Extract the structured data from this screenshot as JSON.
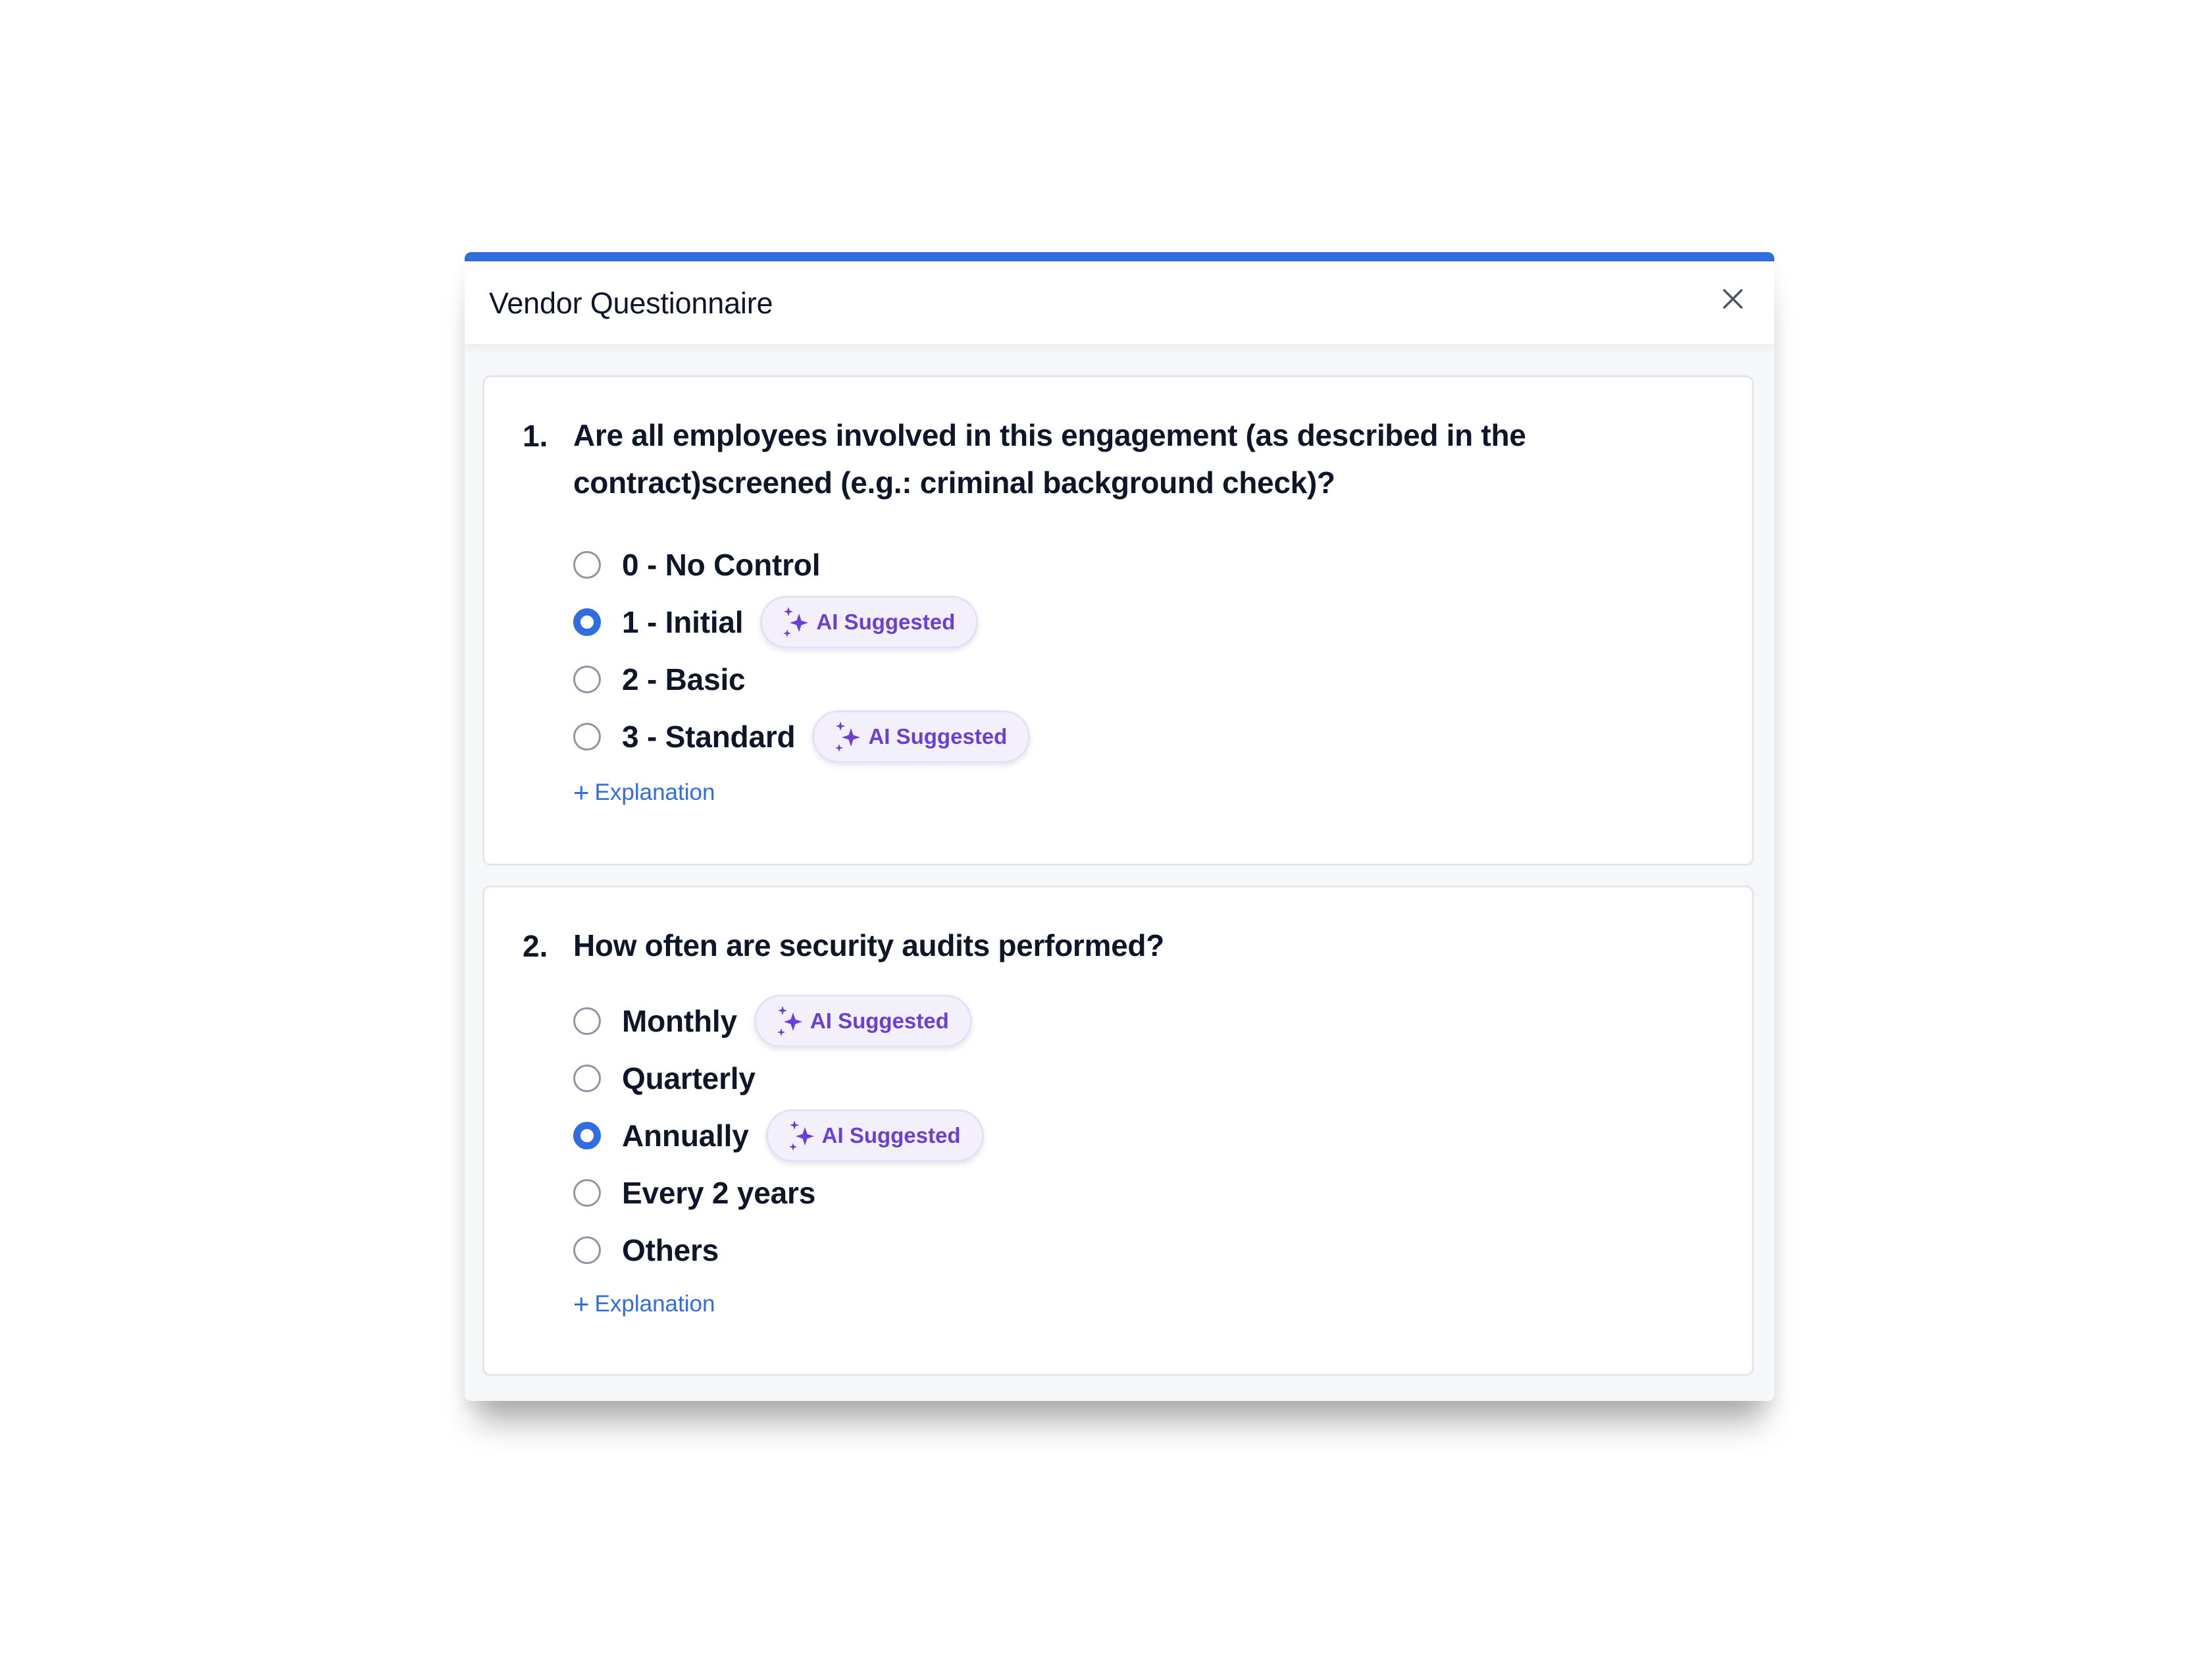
{
  "modal": {
    "title": "Vendor Questionnaire",
    "accent_color": "#2f6de0"
  },
  "questions": [
    {
      "number": "1.",
      "text": "Are all employees involved in this engagement (as described in the contract)screened (e.g.: criminal background check)?",
      "options": [
        {
          "label": "0 - No Control",
          "selected": false,
          "ai_suggested": false
        },
        {
          "label": "1 - Initial",
          "selected": true,
          "ai_suggested": true
        },
        {
          "label": "2 - Basic",
          "selected": false,
          "ai_suggested": false
        },
        {
          "label": "3 - Standard",
          "selected": false,
          "ai_suggested": true
        }
      ],
      "explanation_label": "Explanation"
    },
    {
      "number": "2.",
      "text": "How often are security audits performed?",
      "options": [
        {
          "label": "Monthly",
          "selected": false,
          "ai_suggested": true
        },
        {
          "label": "Quarterly",
          "selected": false,
          "ai_suggested": false
        },
        {
          "label": "Annually",
          "selected": true,
          "ai_suggested": true
        },
        {
          "label": "Every 2 years",
          "selected": false,
          "ai_suggested": false
        },
        {
          "label": "Others",
          "selected": false,
          "ai_suggested": false
        }
      ],
      "explanation_label": "Explanation"
    }
  ],
  "ai_badge": {
    "label": "AI Suggested",
    "icon": "sparkles-icon",
    "color": "#6a3fd6"
  },
  "icons": {
    "close": "close-icon",
    "plus": "+"
  }
}
